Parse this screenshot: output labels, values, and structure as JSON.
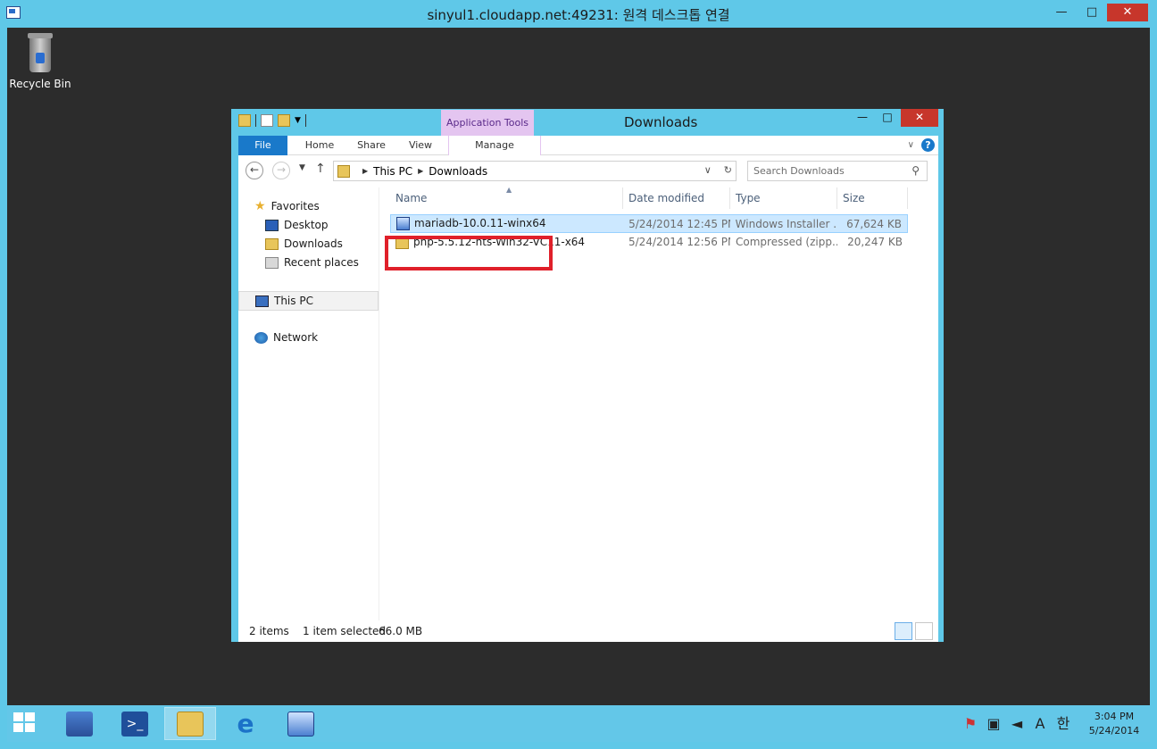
{
  "rdp": {
    "title": "sinyul1.cloudapp.net:49231: 원격 데스크톱 연결",
    "min": "—",
    "max": "□",
    "close": "✕"
  },
  "desktop": {
    "recycle_bin_label": "Recycle Bin"
  },
  "explorer": {
    "title": "Downloads",
    "contextual_tab": "Application Tools",
    "window_buttons": {
      "min": "—",
      "max": "□",
      "close": "✕"
    },
    "ribbon_tabs": [
      "File",
      "Home",
      "Share",
      "View",
      "Manage"
    ],
    "breadcrumb": [
      "This PC",
      "Downloads"
    ],
    "search_placeholder": "Search Downloads",
    "nav": {
      "favorites": "Favorites",
      "desktop": "Desktop",
      "downloads": "Downloads",
      "recent": "Recent places",
      "this_pc": "This PC",
      "network": "Network"
    },
    "columns": [
      "Name",
      "Date modified",
      "Type",
      "Size"
    ],
    "files": [
      {
        "name": "mariadb-10.0.11-winx64",
        "date": "5/24/2014 12:45 PM",
        "type": "Windows Installer ...",
        "size": "67,624 KB",
        "selected": true,
        "icon": "msi-icon"
      },
      {
        "name": "php-5.5.12-nts-Win32-VC11-x64",
        "date": "5/24/2014 12:56 PM",
        "type": "Compressed (zipp...",
        "size": "20,247 KB",
        "selected": false,
        "icon": "zip-folder-icon"
      }
    ],
    "status": {
      "items": "2 items",
      "selection": "1 item selected",
      "size": "66.0 MB"
    }
  },
  "taskbar": {
    "clock_time": "3:04 PM",
    "clock_date": "5/24/2014",
    "ime_mode": "A",
    "ime_lang": "한"
  },
  "colors": {
    "accent": "#5fc8e8",
    "file_tab": "#1979ca",
    "highlight": "#e0202a",
    "selection": "#cce8ff"
  }
}
